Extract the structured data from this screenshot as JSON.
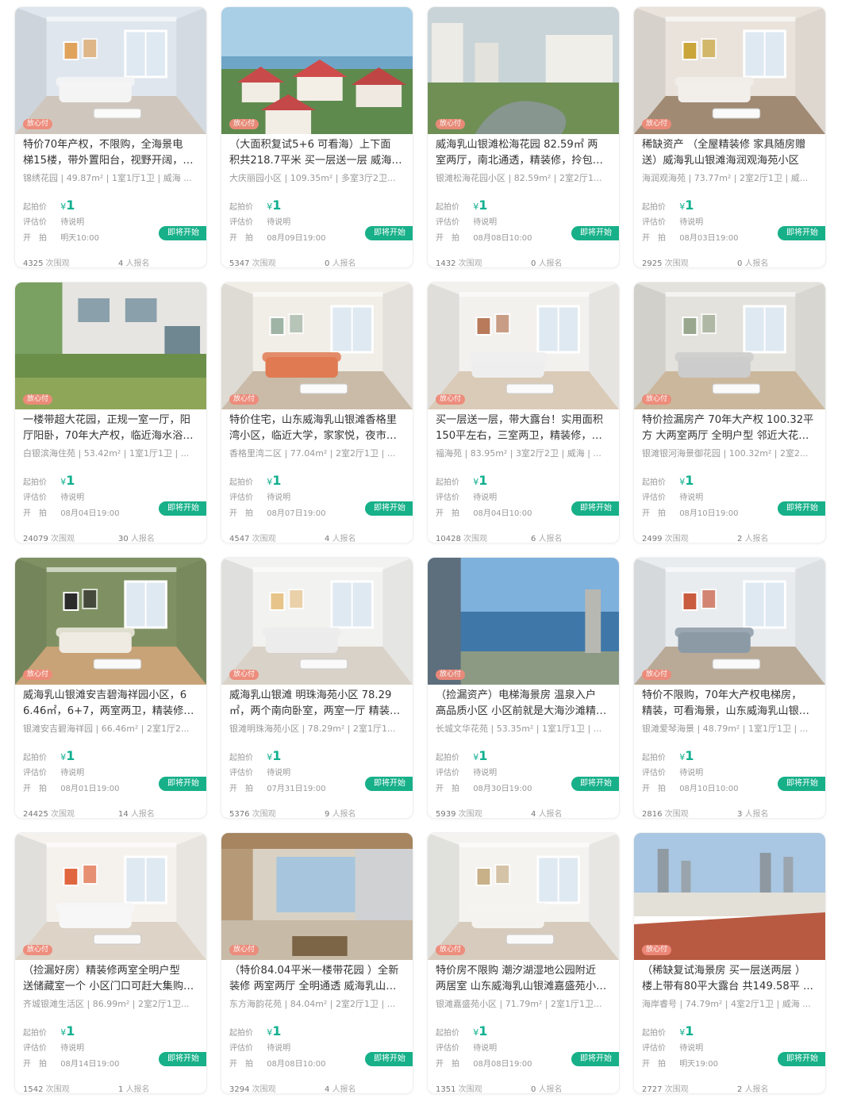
{
  "labels": {
    "start_price": "起拍价",
    "eval_price": "评估价",
    "auction_time": "开　拍",
    "eval_pending": "待说明",
    "badge": "放心付",
    "cta": "即将开始",
    "views_suffix": "次围观",
    "signups_suffix": "人报名",
    "currency": "¥"
  },
  "colors": {
    "accent": "#17b089",
    "badge": "#ef8a7a",
    "text": "#333333",
    "muted": "#999999"
  },
  "listings": [
    {
      "title1": "特价70年产权，不限购，全海景电",
      "title2": "梯15楼，带外置阳台，视野开阔，…",
      "meta": "锦绣花园 | 49.87m² | 1室1厅1卫 | 威海 ...",
      "price": "1",
      "time": "明天10:00",
      "views": "4325",
      "signups": "4",
      "photo": "room-blue"
    },
    {
      "title1": "（大面积复试5+6 可看海）上下面",
      "title2": "积共218.7平米 买一层送一层 威海…",
      "meta": "大庆丽园小区 | 109.35m² | 多室3厅2卫...",
      "price": "1",
      "time": "08月09日19:00",
      "views": "5347",
      "signups": "0",
      "photo": "redroof"
    },
    {
      "title1": "威海乳山银滩松海花园 82.59㎡ 两",
      "title2": "室两厅，南北通透，精装修，拎包…",
      "meta": "银滩松海花园小区 | 82.59m² | 2室2厅1...",
      "price": "1",
      "time": "08月08日10:00",
      "views": "1432",
      "signups": "0",
      "photo": "pond"
    },
    {
      "title1": "稀缺资产 （全屋精装修 家具随房赠",
      "title2": "送）威海乳山银滩海润观海苑小区",
      "meta": "海润观海苑 | 73.77m² | 2室2厅1卫 | 威...",
      "price": "1",
      "time": "08月03日19:00",
      "views": "2925",
      "signups": "0",
      "photo": "room-art"
    },
    {
      "title1": "一楼带超大花园，正规一室一厅，阳",
      "title2": "厅阳卧，70年大产权，临近海水浴…",
      "meta": "白银滨海住苑 | 53.42m² | 1室1厅1卫 | ...",
      "price": "1",
      "time": "08月04日19:00",
      "views": "24079",
      "signups": "30",
      "photo": "garden"
    },
    {
      "title1": "特价住宅，山东威海乳山银滩香格里",
      "title2": "湾小区，临近大学，家家悦，夜市…",
      "meta": "香格里湾二区 | 77.04m² | 2室2厅1卫 | ...",
      "price": "1",
      "time": "08月07日19:00",
      "views": "4547",
      "signups": "4",
      "photo": "room-sofa"
    },
    {
      "title1": "买一层送一层，带大露台！实用面积",
      "title2": "150平左右，三室两卫，精装修，…",
      "meta": "福海苑 | 83.95m² | 3室2厅2卫 | 威海 | ...",
      "price": "1",
      "time": "08月04日10:00",
      "views": "10428",
      "signups": "6",
      "photo": "room-white"
    },
    {
      "title1": "特价捡漏房产 70年大产权 100.32平",
      "title2": "方 大两室两厅 全明户型 邻近大花…",
      "meta": "银滩银河海景御花园 | 100.32m² | 2室2...",
      "price": "1",
      "time": "08月10日19:00",
      "views": "2499",
      "signups": "2",
      "photo": "room-grey"
    },
    {
      "title1": "威海乳山银滩安吉碧海祥园小区，6",
      "title2": "6.46㎡，6+7，两室两卫，精装修…",
      "meta": "银滩安吉碧海祥园 | 66.46m² | 2室1厅2...",
      "price": "1",
      "time": "08月01日19:00",
      "views": "24425",
      "signups": "14",
      "photo": "room-green"
    },
    {
      "title1": "威海乳山银滩 明珠海苑小区 78.29",
      "title2": "㎡，两个南向卧室，两室一厅 精装…",
      "meta": "银滩明珠海苑小区 | 78.29m² | 2室1厅1...",
      "price": "1",
      "time": "07月31日19:00",
      "views": "5376",
      "signups": "9",
      "photo": "room-bright"
    },
    {
      "title1": "（捡漏资产）电梯海景房 温泉入户",
      "title2": "高品质小区 小区前就是大海沙滩精…",
      "meta": "长城文华花苑 | 53.35m² | 1室1厅1卫 | ...",
      "price": "1",
      "time": "08月30日19:00",
      "views": "5939",
      "signups": "4",
      "photo": "sea"
    },
    {
      "title1": "特价不限购，70年大产权电梯房，",
      "title2": "精装，可看海景，山东威海乳山银…",
      "meta": "银滩爱琴海景 | 48.79m² | 1室1厅1卫 | ...",
      "price": "1",
      "time": "08月10日10:00",
      "views": "2816",
      "signups": "3",
      "photo": "room-mirror"
    },
    {
      "title1": "（捡漏好房）精装修两室全明户型",
      "title2": "送储藏室一个 小区门口可赶大集购…",
      "meta": "齐城银滩生活区 | 86.99m² | 2室2厅1卫...",
      "price": "1",
      "time": "08月14日19:00",
      "views": "1542",
      "signups": "1",
      "photo": "room-orange"
    },
    {
      "title1": "（特价84.04平米一楼带花园 ）全新",
      "title2": "装修 两室两厅 全明通透 威海乳山…",
      "meta": "东方海韵花苑 | 84.04m² | 2室2厅1卫 | ...",
      "price": "1",
      "time": "08月08日10:00",
      "views": "3294",
      "signups": "4",
      "photo": "balcony"
    },
    {
      "title1": "特价房不限购 潮汐湖湿地公园附近",
      "title2": "两居室 山东威海乳山银滩嘉盛苑小…",
      "meta": "银滩嘉盛苑小区 | 71.79m² | 2室1厅1卫...",
      "price": "1",
      "time": "08月08日19:00",
      "views": "1351",
      "signups": "0",
      "photo": "room-empty"
    },
    {
      "title1": "（稀缺复试海景房 买一层送两层 ）",
      "title2": "楼上带有80平大露台 共149.58平 ...",
      "meta": "海岸睿号 | 74.79m² | 4室2厅1卫 | 威海 ...",
      "price": "1",
      "time": "明天19:00",
      "views": "2727",
      "signups": "2",
      "photo": "rooftop"
    }
  ]
}
